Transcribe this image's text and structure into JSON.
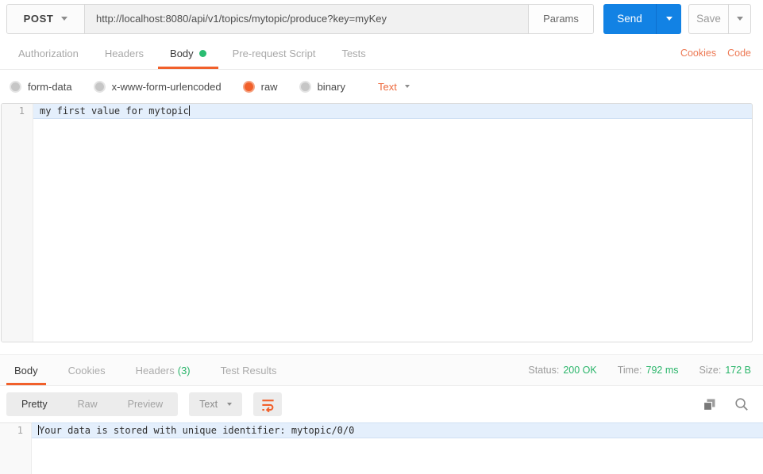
{
  "request_bar": {
    "method": "POST",
    "url": "http://localhost:8080/api/v1/topics/mytopic/produce?key=myKey",
    "params_label": "Params",
    "send_label": "Send",
    "save_label": "Save"
  },
  "request_tabs": {
    "items": [
      {
        "label": "Authorization"
      },
      {
        "label": "Headers"
      },
      {
        "label": "Body"
      },
      {
        "label": "Pre-request Script"
      },
      {
        "label": "Tests"
      }
    ],
    "active_tab": "Body",
    "cookies_link": "Cookies",
    "code_link": "Code"
  },
  "body_options": {
    "modes": [
      {
        "label": "form-data",
        "selected": false
      },
      {
        "label": "x-www-form-urlencoded",
        "selected": false
      },
      {
        "label": "raw",
        "selected": true
      },
      {
        "label": "binary",
        "selected": false
      }
    ],
    "selected_mode": "raw",
    "format_selector": "Text"
  },
  "request_editor": {
    "line_number": "1",
    "content": "my first value for mytopic"
  },
  "response": {
    "tabs": [
      "Body",
      "Cookies",
      "Headers",
      "Test Results"
    ],
    "active_tab": "Body",
    "headers_count": "(3)",
    "status_label": "Status:",
    "status_value": "200 OK",
    "time_label": "Time:",
    "time_value": "792 ms",
    "size_label": "Size:",
    "size_value": "172 B",
    "view_modes": [
      "Pretty",
      "Raw",
      "Preview"
    ],
    "active_view": "Pretty",
    "format_selector": "Text",
    "editor": {
      "line_number": "1",
      "content": "Your data is stored with unique identifier: mytopic/0/0"
    }
  },
  "icons": {
    "method_caret": "chevron-down",
    "send_caret": "chevron-down",
    "save_caret": "chevron-down",
    "format_caret": "chevron-down",
    "body_dot": "green-status-dot",
    "wrap": "text-wrap-arrow",
    "copy": "overlapping-squares",
    "search": "magnifier"
  },
  "colors": {
    "accent_orange": "#f1602b",
    "link_orange": "#ed7a55",
    "send_blue": "#1282e4",
    "status_green": "#2ab56a",
    "active_line_blue": "#e4effc"
  }
}
